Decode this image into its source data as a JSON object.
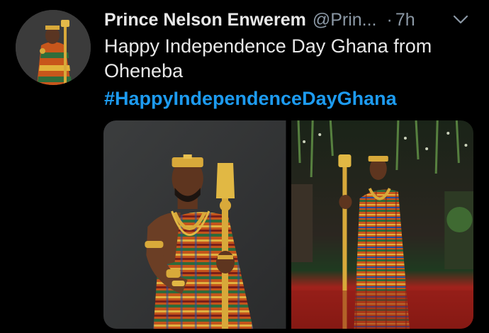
{
  "tweet": {
    "author_name": "Prince Nelson Enwerem",
    "handle": "@Prin...",
    "separator": "·",
    "timestamp": "7h",
    "text": "Happy Independence Day Ghana from Oheneba",
    "hashtag": "#HappyIndependenceDayGhana"
  },
  "icons": {
    "menu": "chevron-down-icon",
    "avatar": "avatar"
  },
  "colors": {
    "background": "#000000",
    "name": "#e8e8e8",
    "secondary": "#8b98a5",
    "hashtag": "#1d9bf0",
    "kente_orange": "#d96b1a",
    "kente_green": "#2d6b3a",
    "gold": "#d8a93a"
  }
}
